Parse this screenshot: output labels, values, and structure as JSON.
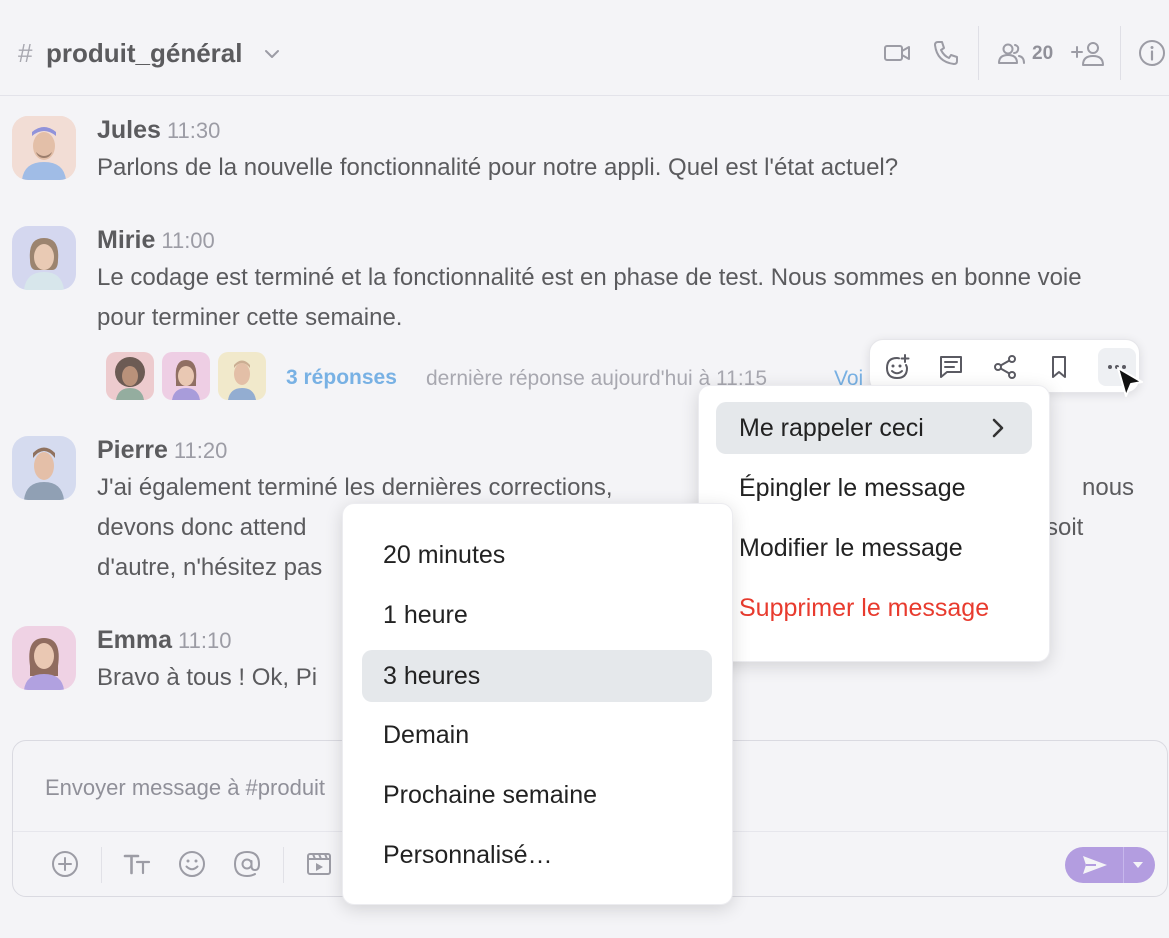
{
  "header": {
    "hash": "#",
    "channel": "produit_général",
    "member_count": "20",
    "icons": [
      "chevron-down-icon",
      "video-icon",
      "phone-icon",
      "members-icon",
      "add-user-icon",
      "info-icon"
    ]
  },
  "messages": [
    {
      "sender": "Jules",
      "time": "11:30",
      "text": "Parlons de la nouvelle fonctionnalité pour notre appli. Quel est l'état actuel?"
    },
    {
      "sender": "Mirie",
      "time": "11:00",
      "text": "Le codage est terminé et la fonctionnalité est en phase de test. Nous sommes en bonne voie pour terminer cette semaine."
    },
    {
      "sender": "Pierre",
      "time": "11:20",
      "text": "J'ai également terminé les dernières corrections, nous devons donc attend soit d'autre, n'hésitez pas"
    },
    {
      "sender": "Emma",
      "time": "11:10",
      "text": "Bravo à tous ! Ok, Pi"
    }
  ],
  "pierre_lines": [
    "J'ai également terminé les dernières corrections,",
    "nous",
    "devons donc attend",
    "soit",
    "d'autre, n'hésitez pas"
  ],
  "thread": {
    "replies": "3 réponses",
    "last_reply": "dernière réponse aujourd'hui à 11:15",
    "see": "Voi"
  },
  "action_bar": [
    "add-reaction-icon",
    "reply-thread-icon",
    "share-icon",
    "bookmark-icon",
    "more-icon"
  ],
  "message_menu": [
    {
      "label": "Me rappeler ceci",
      "active": true
    },
    {
      "label": "Épingler le message"
    },
    {
      "label": "Modifier le message"
    },
    {
      "label": "Supprimer le message",
      "danger": true
    }
  ],
  "reminder_menu": [
    {
      "label": "20 minutes"
    },
    {
      "label": "1 heure"
    },
    {
      "label": "3 heures",
      "active": true
    },
    {
      "label": "Demain"
    },
    {
      "label": "Prochaine semaine"
    },
    {
      "label": "Personnalisé…"
    }
  ],
  "composer": {
    "placeholder": "Envoyer message à #produit",
    "toolbar_icons": [
      "add-icon",
      "text-format-icon",
      "emoji-icon",
      "mention-icon",
      "media-icon",
      "send-icon",
      "send-options-chevron-icon"
    ]
  },
  "colors": {
    "accent": "#a98be0",
    "link": "#5aa6e6",
    "danger": "#e83b2e",
    "active_bg": "#e5e8eb"
  }
}
